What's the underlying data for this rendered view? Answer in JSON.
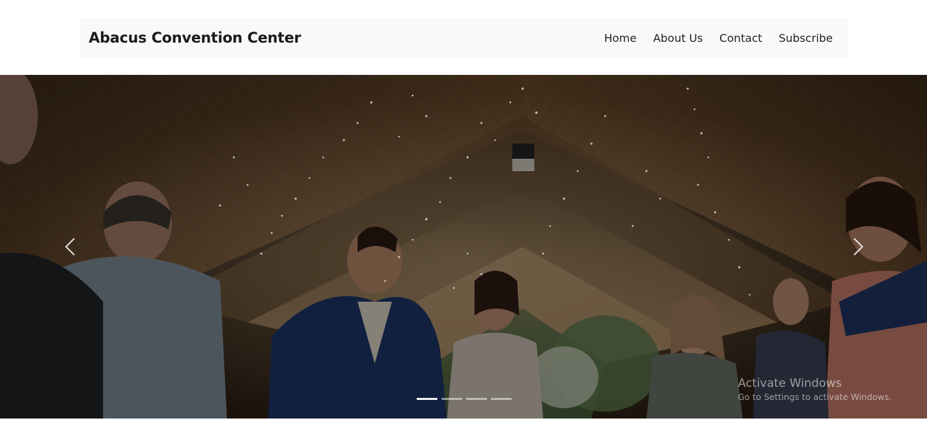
{
  "navbar": {
    "brand": "Abacus Convention Center",
    "links": [
      "Home",
      "About Us",
      "Contact",
      "Subscribe"
    ]
  },
  "carousel": {
    "slide_count": 4,
    "active_index": 0,
    "prev_icon": "chevron-left-icon",
    "next_icon": "chevron-right-icon",
    "image_description": "wedding couple walking through guests showering rice under wooden chapel roof"
  },
  "watermark": {
    "title": "Activate Windows",
    "subtitle": "Go to Settings to activate Windows."
  },
  "colors": {
    "navbar_bg": "#f8f9fa",
    "brand_text": "#1a1a1a",
    "link_text": "#222222"
  }
}
